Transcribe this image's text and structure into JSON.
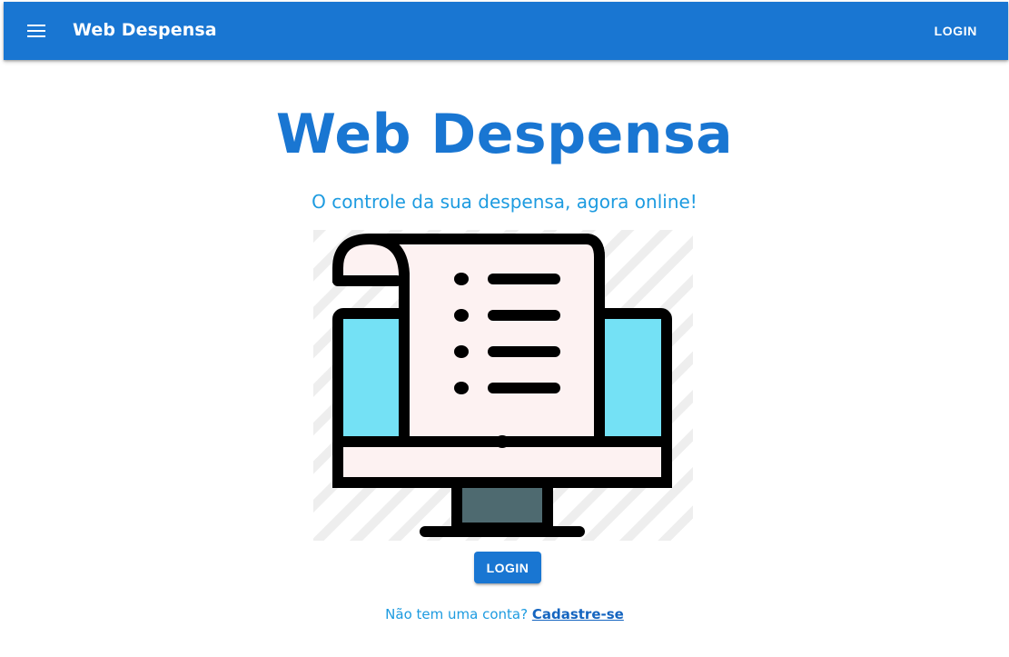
{
  "appbar": {
    "menu_icon": "menu-icon",
    "title": "Web Despensa",
    "login_label": "LOGIN",
    "background": "#1976d2"
  },
  "hero": {
    "title": "Web Despensa",
    "subtitle": "O controle da sua despensa, agora online!",
    "illustration_icon": "online-shopping-list-monitor-icon",
    "title_color": "#1976d2",
    "subtitle_color": "#1d9be0"
  },
  "cta": {
    "login_label": "LOGIN"
  },
  "signup": {
    "prompt": "Não tem uma conta?",
    "link_label": "Cadastre-se"
  }
}
